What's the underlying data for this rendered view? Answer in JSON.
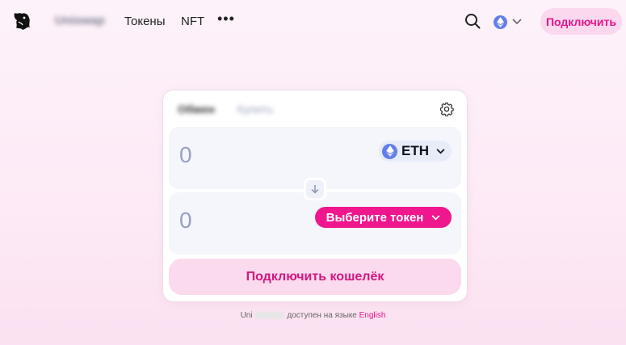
{
  "nav": {
    "brand": "Uniswap",
    "links": [
      "Токены",
      "NFT"
    ],
    "more": "•••",
    "connect_label": "Подключить"
  },
  "swap": {
    "tabs": [
      "Обмен",
      "Купить"
    ],
    "sell": {
      "amount": "0",
      "token": "ETH"
    },
    "buy": {
      "amount": "0",
      "select_label": "Выберите токен"
    },
    "connect_wallet_label": "Подключить кошелёк"
  },
  "footer": {
    "prefix": "Uni",
    "text": "доступен на языке",
    "language": "English"
  },
  "colors": {
    "accent": "#f0168e",
    "accent_soft": "#fcdaee",
    "eth": "#627eea"
  }
}
